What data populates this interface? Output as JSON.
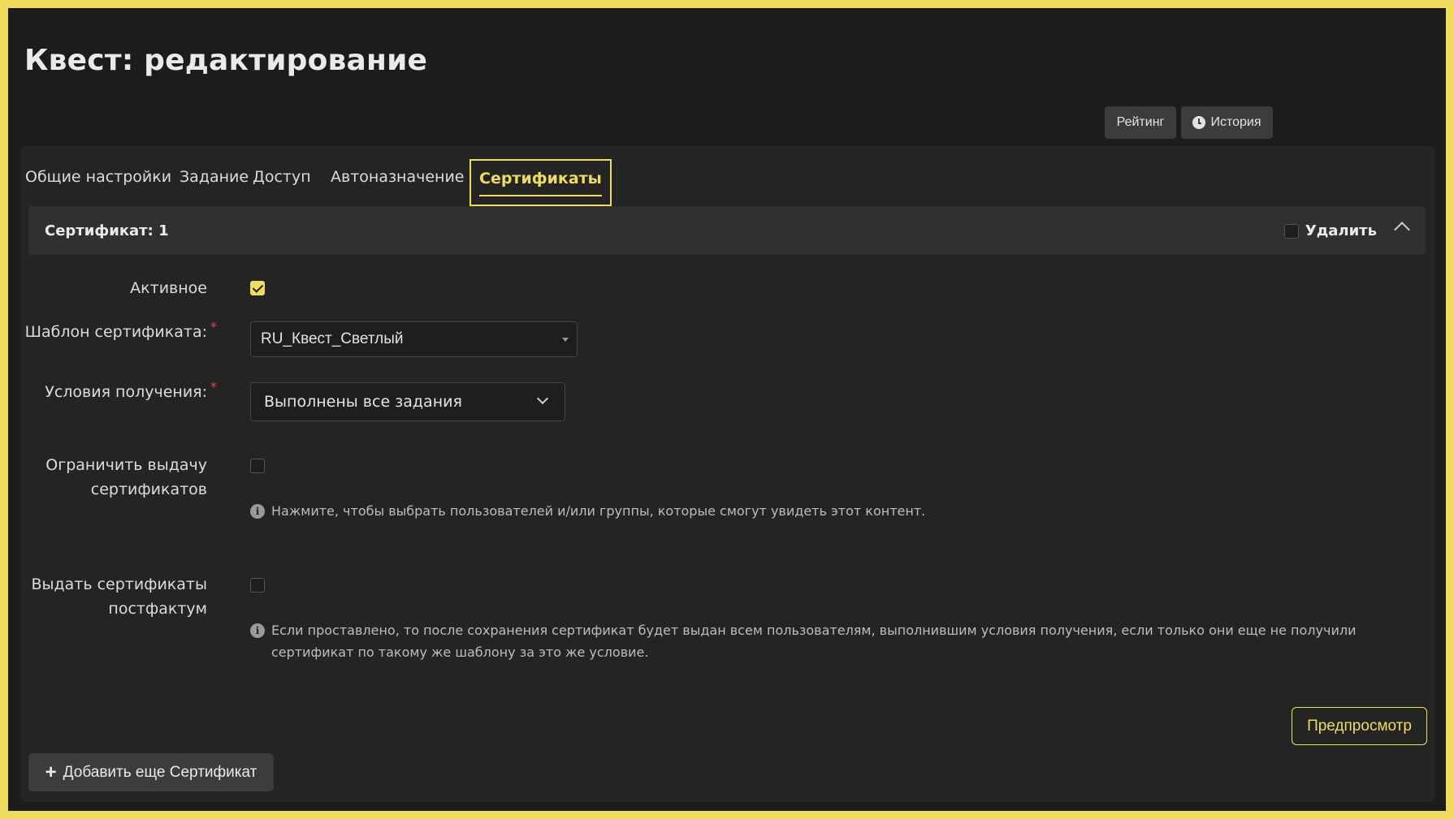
{
  "page": {
    "title": "Квест: редактирование"
  },
  "top_buttons": {
    "rating": "Рейтинг",
    "history": "История"
  },
  "tabs": [
    {
      "label": "Общие настройки",
      "active": false
    },
    {
      "label": "Задание",
      "active": false
    },
    {
      "label": "Доступ",
      "active": false
    },
    {
      "label": "Автоназначение",
      "active": false
    },
    {
      "label": "Сертификаты",
      "active": true
    }
  ],
  "certificate": {
    "header": "Сертификат: 1",
    "delete_label": "Удалить",
    "delete_checked": false,
    "active_label": "Активное",
    "active_checked": true,
    "template_label": "Шаблон сертификата:",
    "template_value": "RU_Квест_Светлый",
    "conditions_label": "Условия получения:",
    "conditions_value": "Выполнены все задания",
    "required_mark": "*",
    "limit_label_line1": "Ограничить выдачу",
    "limit_label_line2": "сертификатов",
    "limit_checked": false,
    "limit_hint": "Нажмите, чтобы выбрать пользователей и/или группы, которые смогут увидеть этот контент.",
    "postfact_label_line1": "Выдать сертификаты",
    "postfact_label_line2": "постфактум",
    "postfact_checked": false,
    "postfact_hint": "Если проставлено, то после сохранения сертификат будет выдан всем пользователям, выполнившим условия получения, если только они еще не получили сертификат по такому же шаблону за это же условие."
  },
  "actions": {
    "preview": "Предпросмотр",
    "add_more": "Добавить еще Сертификат"
  },
  "colors": {
    "accent": "#efdc5e",
    "background": "#1c1c1c",
    "panel": "#242424",
    "required": "#e04848"
  },
  "icons": {
    "history": "clock-icon",
    "info": "info-icon",
    "collapse": "chevron-up-icon",
    "add": "plus-icon",
    "dropdown": "chevron-down-icon"
  }
}
